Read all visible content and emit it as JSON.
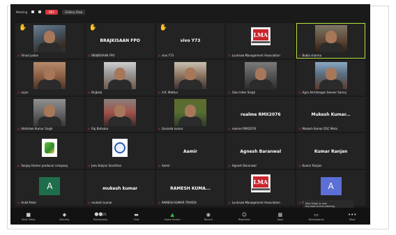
{
  "topbar": {
    "meeting_label": "Meeting",
    "rec_label": "REC",
    "view_label": "Gallery View"
  },
  "participants": [
    {
      "label": "Vinod yadav",
      "kind": "video",
      "hand": true
    },
    {
      "label": "BRAJKISAAN FPO",
      "name": "BRAJKISAAN FPO",
      "kind": "name",
      "hand": true
    },
    {
      "label": "vivo Y73",
      "name": "vivo Y73",
      "kind": "name",
      "hand": true
    },
    {
      "label": "Lucknow Management Association",
      "kind": "lma"
    },
    {
      "label": "Babla sharma",
      "kind": "video",
      "active": true
    },
    {
      "label": "arjun",
      "kind": "video"
    },
    {
      "label": "Brijbala",
      "kind": "video"
    },
    {
      "label": "A.K. Mathur",
      "kind": "video"
    },
    {
      "label": "Gian Inder Singh",
      "kind": "video"
    },
    {
      "label": "Agra Amritangan Seneer Samaj",
      "kind": "video"
    },
    {
      "label": "Abhishek Kumar Singh",
      "kind": "video"
    },
    {
      "label": "Raj Bahadur",
      "kind": "video"
    },
    {
      "label": "Govinda kumar",
      "kind": "video"
    },
    {
      "label": "realme RMX2076",
      "name": "realme RMX2076",
      "kind": "name"
    },
    {
      "label": "Mukesh Kumar DSC Meta",
      "name": "Mukesh Kumar...",
      "kind": "name"
    },
    {
      "label": "Sanjay farmer producer company",
      "kind": "logo-green"
    },
    {
      "label": "Jeev Kalyan Sansthan",
      "kind": "logo-blue"
    },
    {
      "label": "Aamir",
      "name": "Aamir",
      "kind": "name"
    },
    {
      "label": "Agnesh Baranwal",
      "name": "Agnesh Baranwal",
      "kind": "name"
    },
    {
      "label": "Kumar Ranjan",
      "name": "Kumar Ranjan",
      "kind": "name"
    },
    {
      "label": "Ankit Patel",
      "kind": "avatar-green",
      "initial": "A"
    },
    {
      "label": "mukesh kumar",
      "name": "mukesh kumar",
      "kind": "name"
    },
    {
      "label": "RAMESH KUMAR TRIVEDI",
      "name": "RAMESH KUMA...",
      "kind": "name"
    },
    {
      "label": "Lucknow Management Association",
      "kind": "lma"
    },
    {
      "label": "Alka Singh",
      "kind": "avatar-blue",
      "initial": "A"
    }
  ],
  "logo_text": "LMA",
  "toast": {
    "line1": "Alka Singh is now",
    "line2": "the host of this meeting"
  },
  "toolbar": {
    "start_video": "Start Video",
    "security": "Security",
    "participants": "Participants",
    "participants_count": "25",
    "chat": "Chat",
    "share_screen": "Share Screen",
    "record": "Record",
    "reactions": "Reactions",
    "apps": "Apps",
    "whiteboards": "Whiteboards",
    "more": "More"
  },
  "colors": {
    "accent_green": "#2ec44b",
    "active_border": "#b6e23a",
    "rec_red": "#d9363e"
  }
}
